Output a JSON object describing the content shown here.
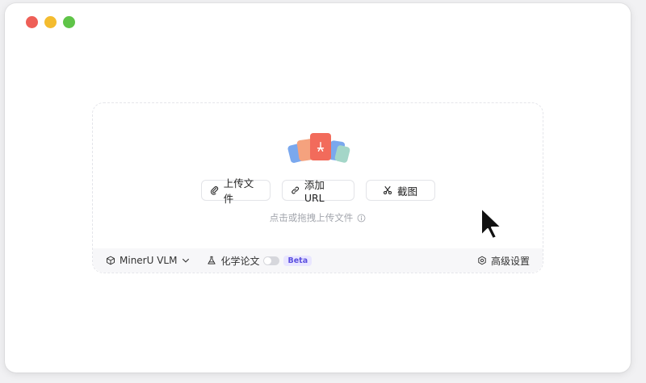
{
  "upload": {
    "upload_file_label": "上传文件",
    "add_url_label": "添加 URL",
    "screenshot_label": "截图",
    "hint": "点击或拖拽上传文件"
  },
  "footer": {
    "model_label": "MinerU VLM",
    "chem_label": "化学论文",
    "beta_label": "Beta",
    "settings_label": "高级设置"
  },
  "colors": {
    "accent": "#5b4fe0",
    "pdf_red": "#f26b5b",
    "doc_blue": "#7aa8ee",
    "doc_orange": "#f5a27e",
    "doc_green": "#a4d6c8"
  },
  "chem_toggle_on": false
}
